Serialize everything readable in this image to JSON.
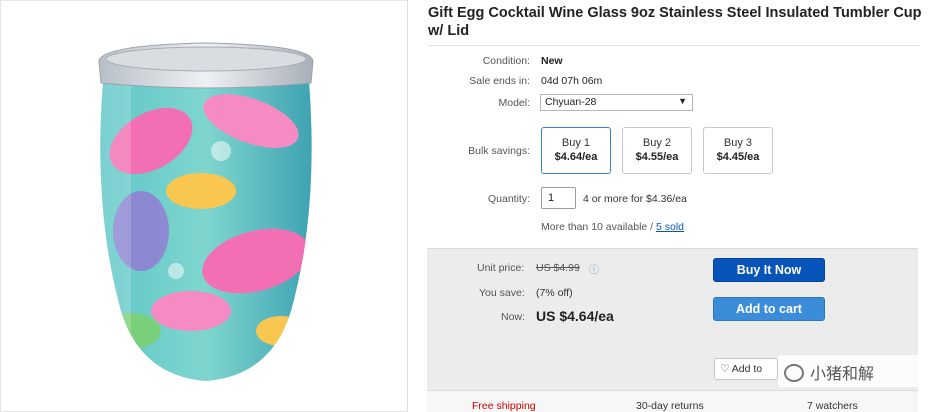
{
  "product": {
    "title": "Gift Egg Cocktail Wine Glass 9oz Stainless Steel Insulated Tumbler Cup w/ Lid",
    "image_alt_icon": "tumbler-image"
  },
  "details": {
    "condition_label": "Condition:",
    "condition_value": "New",
    "sale_label": "Sale ends in:",
    "sale_value": "04d 07h 06m",
    "model_label": "Model:",
    "model_value": "Chyuan-28",
    "bulk_label": "Bulk savings:",
    "bulk_options": [
      {
        "buy": "Buy 1",
        "price": "$4.64/ea"
      },
      {
        "buy": "Buy 2",
        "price": "$4.55/ea"
      },
      {
        "buy": "Buy 3",
        "price": "$4.45/ea"
      }
    ],
    "quantity_label": "Quantity:",
    "quantity_value": "1",
    "quantity_note": "4 or more for $4.36/ea",
    "available_text": "More than 10 available /",
    "sold_link": "5 sold"
  },
  "pricing": {
    "unit_label": "Unit price:",
    "unit_value": "US $4.99",
    "save_label": "You save:",
    "save_value": "(7% off)",
    "now_label": "Now:",
    "now_value": "US $4.64/ea",
    "buy_now": "Buy It Now",
    "add_to_cart": "Add to cart",
    "watch": "♡ Add to",
    "watermark": "小猪和解"
  },
  "footer": {
    "shipping": "Free shipping",
    "returns": "30-day returns",
    "watchers": "7 watchers"
  },
  "colors": {
    "primary_button": "#0654ba",
    "secondary_button": "#3b8dd9",
    "link": "#0654ba",
    "panel_bg": "#ececec"
  }
}
